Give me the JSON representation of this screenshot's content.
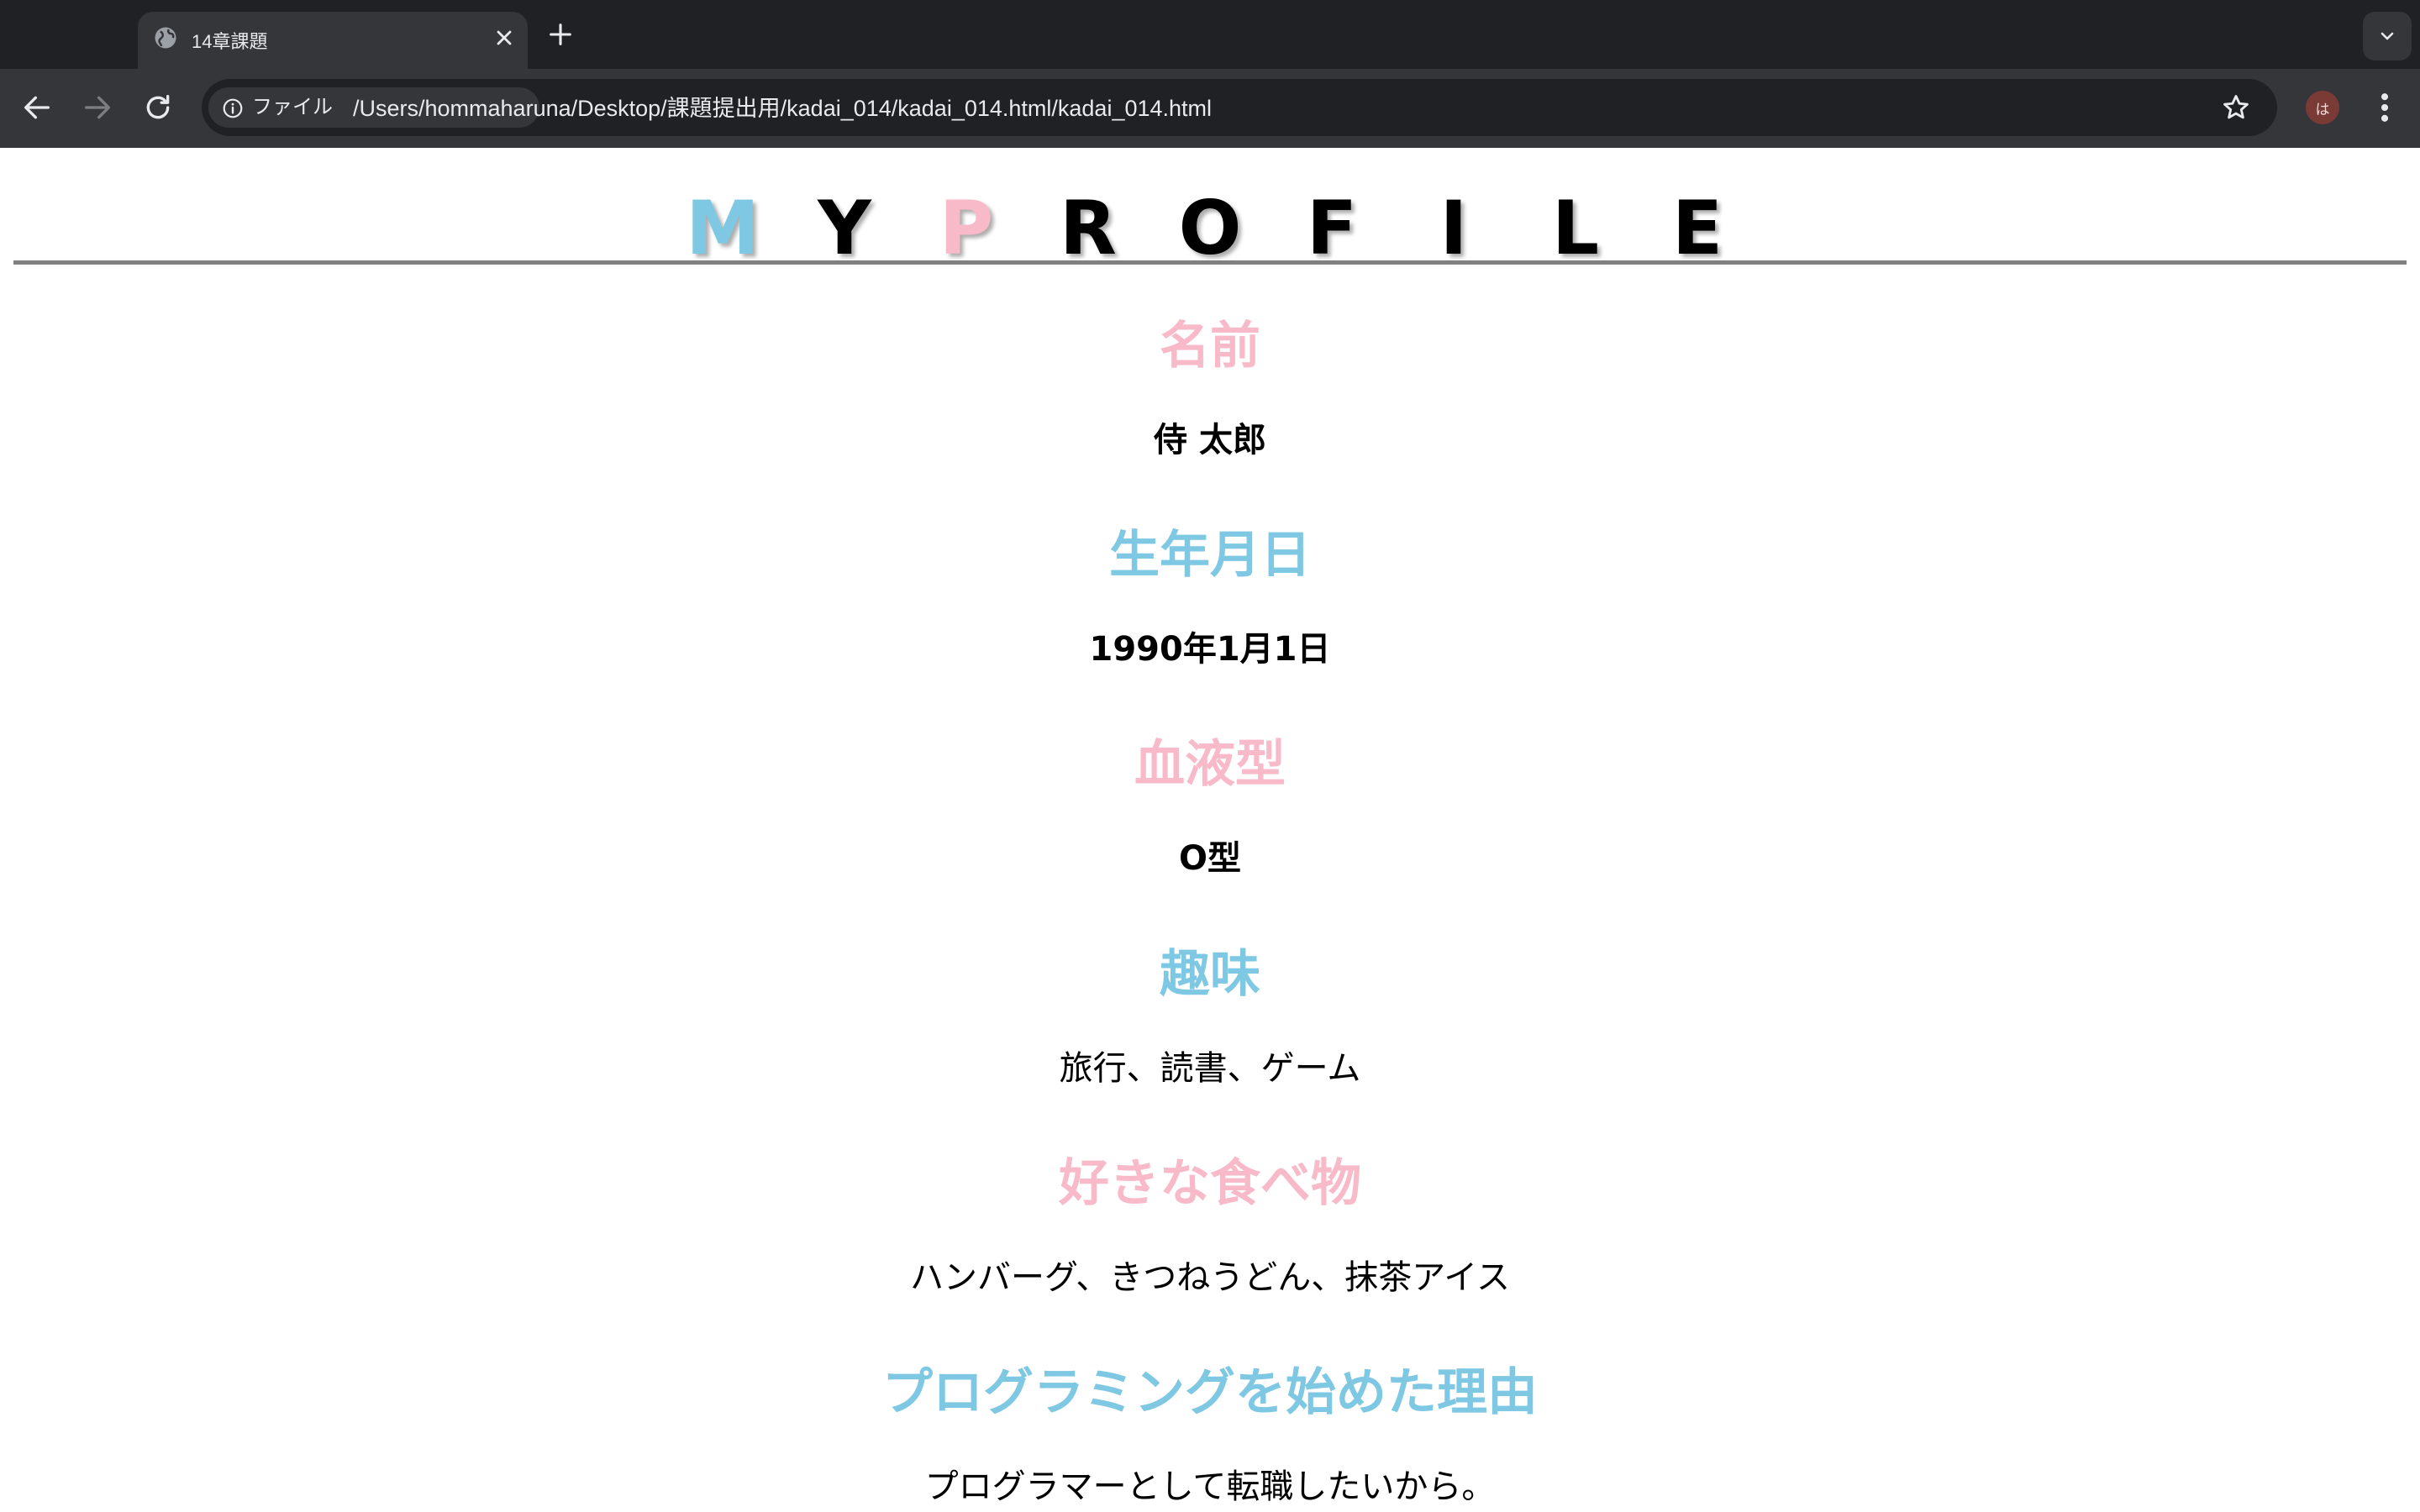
{
  "browser": {
    "tab_title": "14章課題",
    "url_chip": "ファイル",
    "url": "/Users/hommaharuna/Desktop/課題提出用/kadai_014/kadai_014.html/kadai_014.html",
    "profile_initial": "は"
  },
  "page": {
    "logo_letters": [
      "M",
      "Y",
      "P",
      "R",
      "O",
      "F",
      "I",
      "L",
      "E"
    ],
    "colors": {
      "pink": "#f8b9c9",
      "blue": "#7ec8e3",
      "text": "#000000"
    },
    "sections": [
      {
        "heading": "名前",
        "value": "侍 太郎",
        "heading_color": "pink"
      },
      {
        "heading": "生年月日",
        "value": "1990年1月1日",
        "heading_color": "blue"
      },
      {
        "heading": "血液型",
        "value": "O型",
        "heading_color": "pink"
      },
      {
        "heading": "趣味",
        "value": "旅行、読書、ゲーム",
        "heading_color": "blue"
      },
      {
        "heading": "好きな食べ物",
        "value": "ハンバーグ、きつねうどん、抹茶アイス",
        "heading_color": "pink"
      },
      {
        "heading": "プログラミングを始めた理由",
        "value": "プログラマーとして転職したいから。",
        "heading_color": "blue"
      }
    ]
  }
}
